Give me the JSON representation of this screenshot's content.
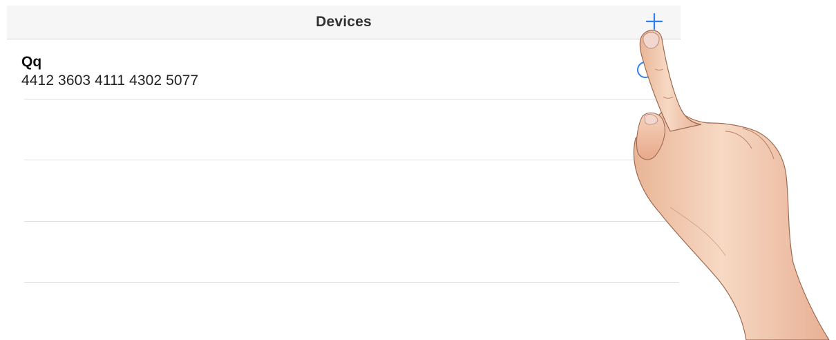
{
  "header": {
    "title": "Devices",
    "add_icon": "plus-icon"
  },
  "devices": [
    {
      "name": "Qq",
      "id": "4412 3603 4111 4302 5077",
      "info_icon": "info-icon"
    }
  ],
  "colors": {
    "accent": "#2f80ed",
    "navbar_bg": "#f6f6f7",
    "separator": "#e0e0e4",
    "title_text": "#333333"
  }
}
